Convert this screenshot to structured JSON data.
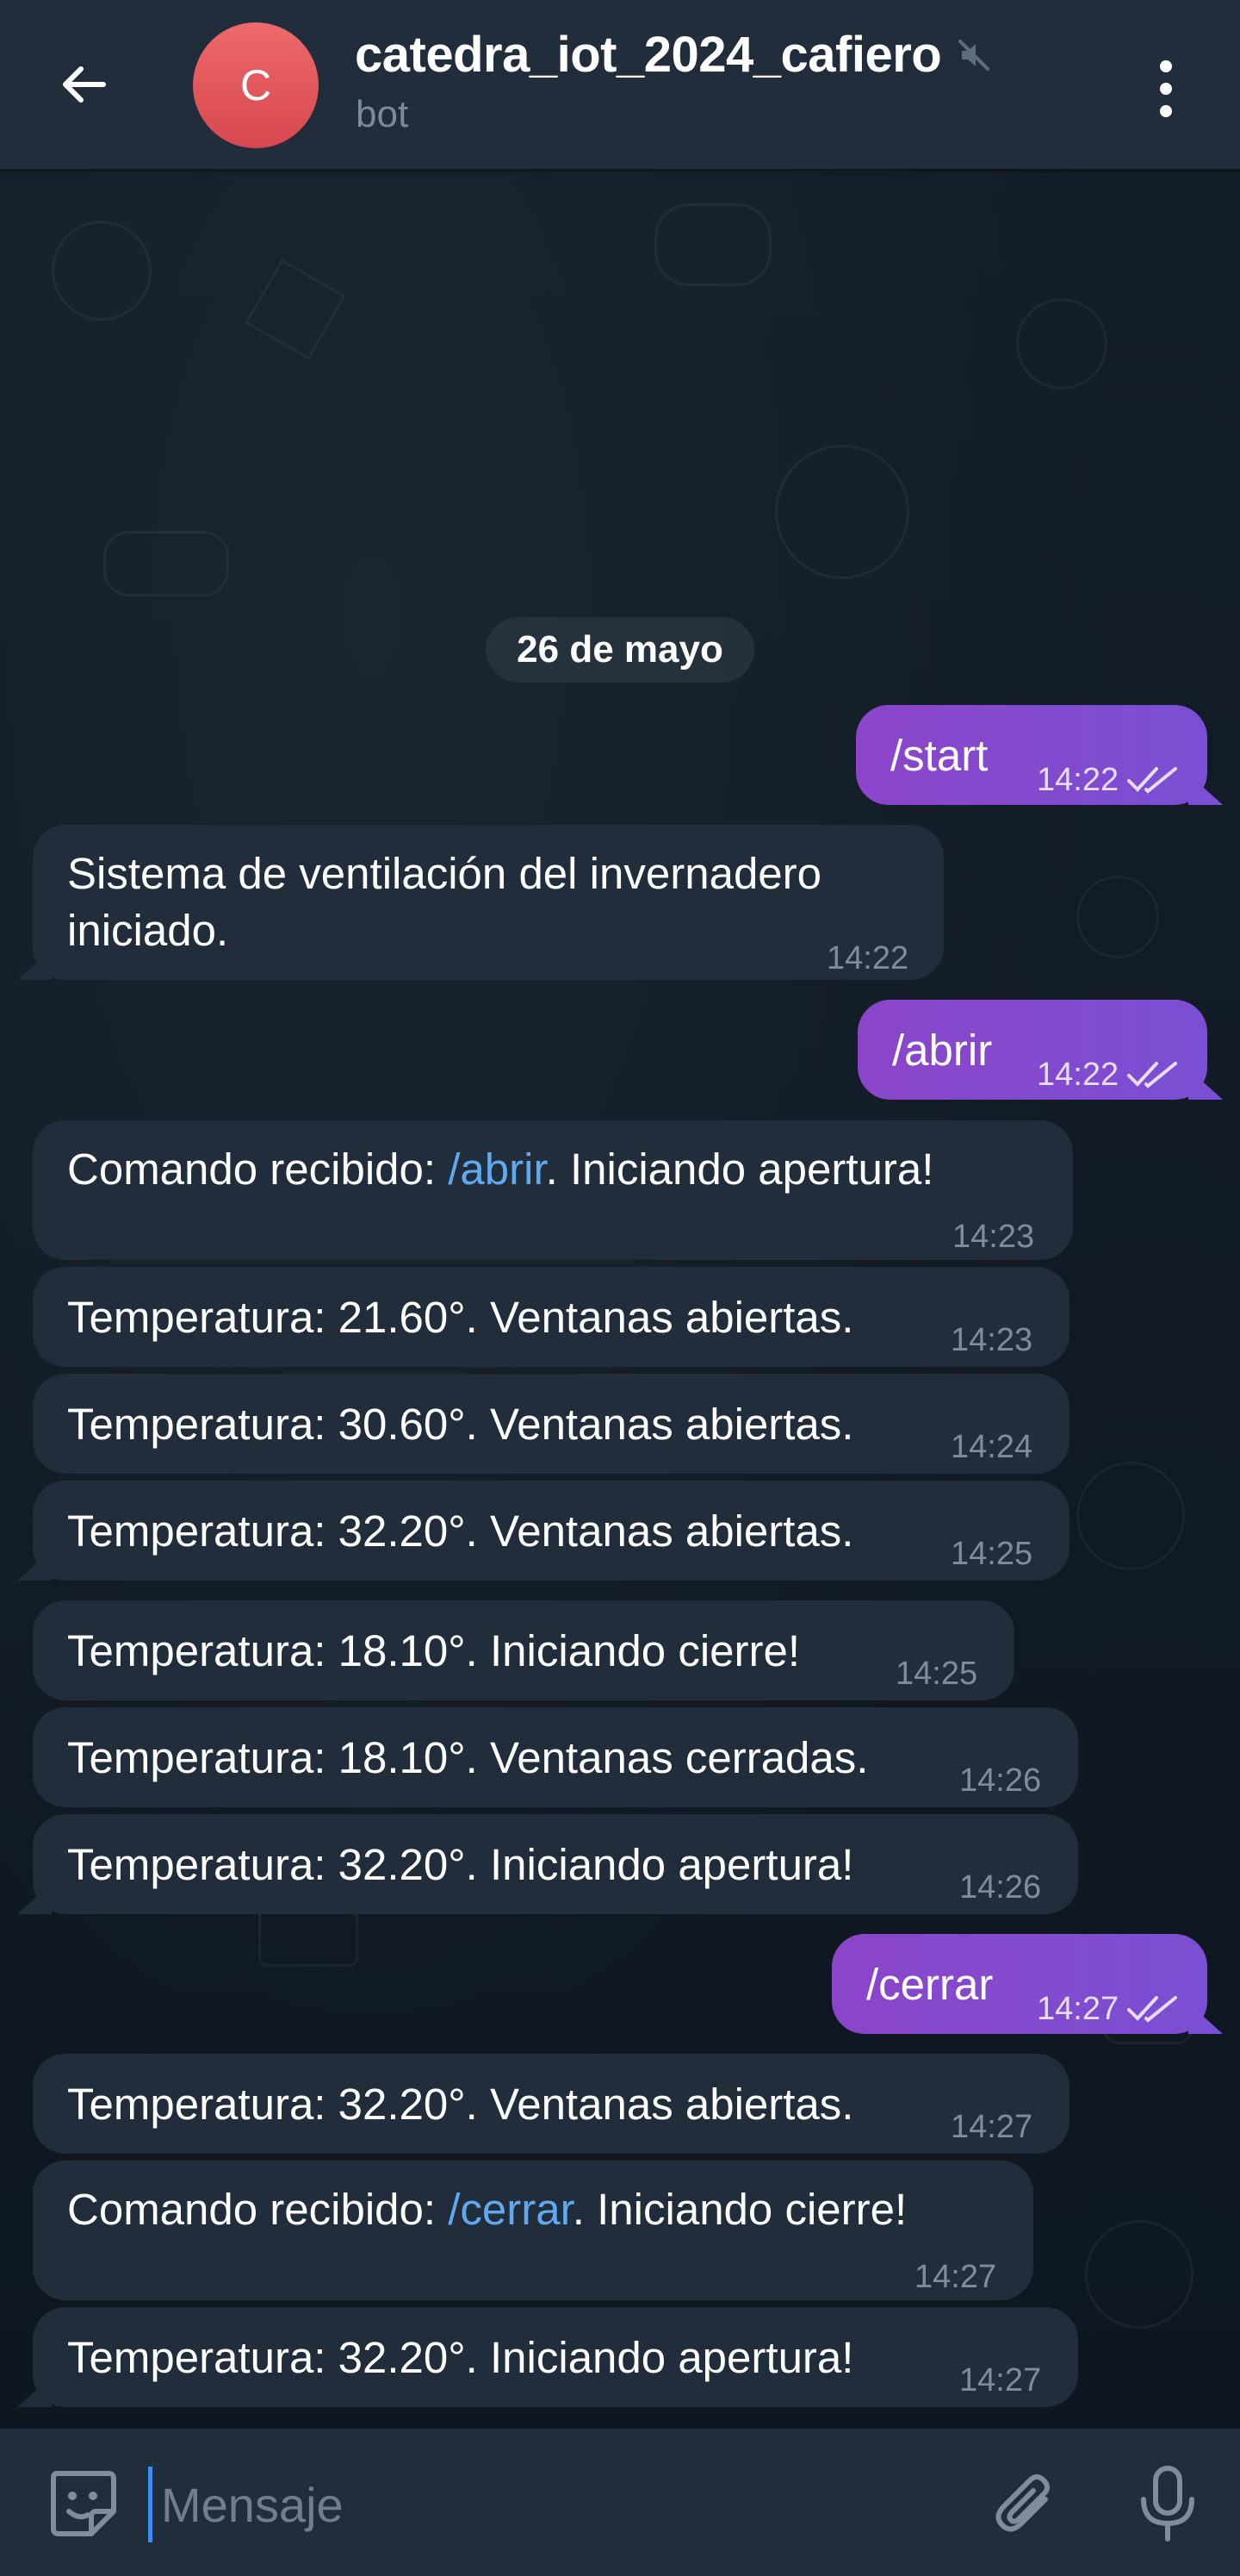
{
  "header": {
    "avatar_letter": "C",
    "title": "catedra_iot_2024_cafiero",
    "subtitle": "bot",
    "avatar_color": "#e25a5e"
  },
  "date_separator": "26 de mayo",
  "messages": [
    {
      "dir": "out",
      "text": "/start",
      "time": "14:22",
      "status": "read"
    },
    {
      "dir": "in",
      "line1": "Sistema de ventilación del invernadero",
      "line2": "iniciado.",
      "time": "14:22"
    },
    {
      "dir": "out",
      "text": "/abrir",
      "time": "14:22",
      "status": "read"
    },
    {
      "dir": "in",
      "prefix": "Comando recibido: ",
      "command": "/abrir",
      "suffix": ". Iniciando apertura!",
      "time": "14:23"
    },
    {
      "dir": "in",
      "text": "Temperatura: 21.60°. Ventanas abiertas.",
      "time": "14:23"
    },
    {
      "dir": "in",
      "text": "Temperatura: 30.60°. Ventanas abiertas.",
      "time": "14:24"
    },
    {
      "dir": "in",
      "text": "Temperatura: 32.20°. Ventanas abiertas.",
      "time": "14:25"
    },
    {
      "dir": "in",
      "text": "Temperatura: 18.10°. Iniciando cierre!",
      "time": "14:25"
    },
    {
      "dir": "in",
      "text": "Temperatura: 18.10°. Ventanas cerradas.",
      "time": "14:26"
    },
    {
      "dir": "in",
      "text": "Temperatura: 32.20°. Iniciando apertura!",
      "time": "14:26"
    },
    {
      "dir": "out",
      "text": "/cerrar",
      "time": "14:27",
      "status": "read"
    },
    {
      "dir": "in",
      "text": "Temperatura: 32.20°. Ventanas abiertas.",
      "time": "14:27"
    },
    {
      "dir": "in",
      "prefix": "Comando recibido: ",
      "command": "/cerrar",
      "suffix": ". Iniciando cierre!",
      "time": "14:27"
    },
    {
      "dir": "in",
      "text": "Temperatura: 32.20°. Iniciando apertura!",
      "time": "14:27"
    }
  ],
  "composer": {
    "placeholder": "Mensaje"
  },
  "icons": {
    "back": "arrow-left-icon",
    "muted": "speaker-muted-icon",
    "menu": "vertical-dots-icon",
    "emoji": "emoji-icon",
    "attach": "paperclip-icon",
    "mic": "microphone-icon",
    "read": "double-check-icon"
  },
  "colors": {
    "header_bg": "#212d3b",
    "incoming_bubble": "#212d3b",
    "outgoing_bubble": "#8b45c9",
    "command_link": "#62a8ee",
    "background": "#0f1922"
  }
}
